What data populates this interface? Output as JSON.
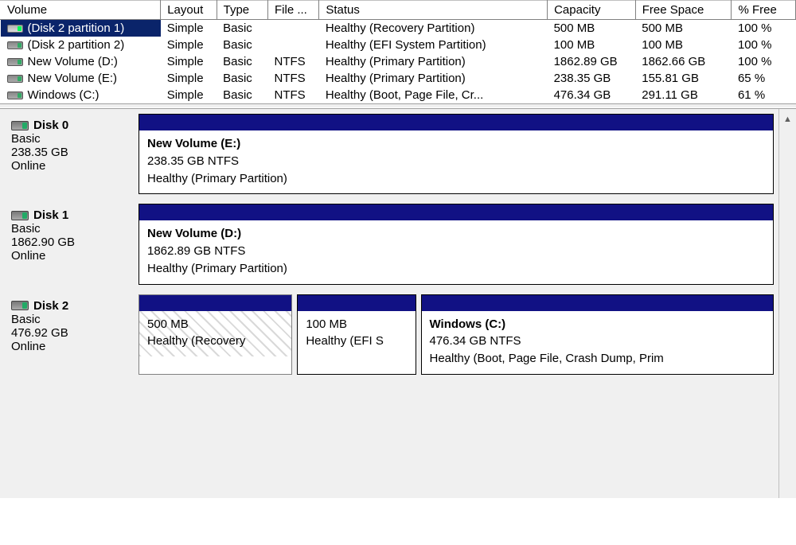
{
  "headers": {
    "volume": "Volume",
    "layout": "Layout",
    "type": "Type",
    "fs": "File ...",
    "status": "Status",
    "capacity": "Capacity",
    "free": "Free Space",
    "pfree": "% Free"
  },
  "volumes": [
    {
      "name": "(Disk 2 partition 1)",
      "layout": "Simple",
      "type": "Basic",
      "fs": "",
      "status": "Healthy (Recovery Partition)",
      "capacity": "500 MB",
      "free": "500 MB",
      "pfree": "100 %",
      "selected": true
    },
    {
      "name": "(Disk 2 partition 2)",
      "layout": "Simple",
      "type": "Basic",
      "fs": "",
      "status": "Healthy (EFI System Partition)",
      "capacity": "100 MB",
      "free": "100 MB",
      "pfree": "100 %",
      "selected": false
    },
    {
      "name": "New Volume (D:)",
      "layout": "Simple",
      "type": "Basic",
      "fs": "NTFS",
      "status": "Healthy (Primary Partition)",
      "capacity": "1862.89 GB",
      "free": "1862.66 GB",
      "pfree": "100 %",
      "selected": false
    },
    {
      "name": "New Volume (E:)",
      "layout": "Simple",
      "type": "Basic",
      "fs": "NTFS",
      "status": "Healthy (Primary Partition)",
      "capacity": "238.35 GB",
      "free": "155.81 GB",
      "pfree": "65 %",
      "selected": false
    },
    {
      "name": "Windows (C:)",
      "layout": "Simple",
      "type": "Basic",
      "fs": "NTFS",
      "status": "Healthy (Boot, Page File, Cr...",
      "capacity": "476.34 GB",
      "free": "291.11 GB",
      "pfree": "61 %",
      "selected": false
    }
  ],
  "disks": [
    {
      "name": "Disk 0",
      "type": "Basic",
      "size": "238.35 GB",
      "state": "Online",
      "parts": [
        {
          "title": "New Volume  (E:)",
          "line2": "238.35 GB NTFS",
          "line3": "Healthy (Primary Partition)",
          "flex": 1,
          "hatched": false
        }
      ]
    },
    {
      "name": "Disk 1",
      "type": "Basic",
      "size": "1862.90 GB",
      "state": "Online",
      "parts": [
        {
          "title": "New Volume  (D:)",
          "line2": "1862.89 GB NTFS",
          "line3": "Healthy (Primary Partition)",
          "flex": 1,
          "hatched": false
        }
      ]
    },
    {
      "name": "Disk 2",
      "type": "Basic",
      "size": "476.92 GB",
      "state": "Online",
      "parts": [
        {
          "title": "",
          "line2": "500 MB",
          "line3": "Healthy (Recovery",
          "flex": 0.26,
          "hatched": true
        },
        {
          "title": "",
          "line2": "100 MB",
          "line3": "Healthy (EFI S",
          "flex": 0.2,
          "hatched": false
        },
        {
          "title": "Windows  (C:)",
          "line2": "476.34 GB NTFS",
          "line3": "Healthy (Boot, Page File, Crash Dump, Prim",
          "flex": 0.6,
          "hatched": false
        }
      ]
    }
  ]
}
